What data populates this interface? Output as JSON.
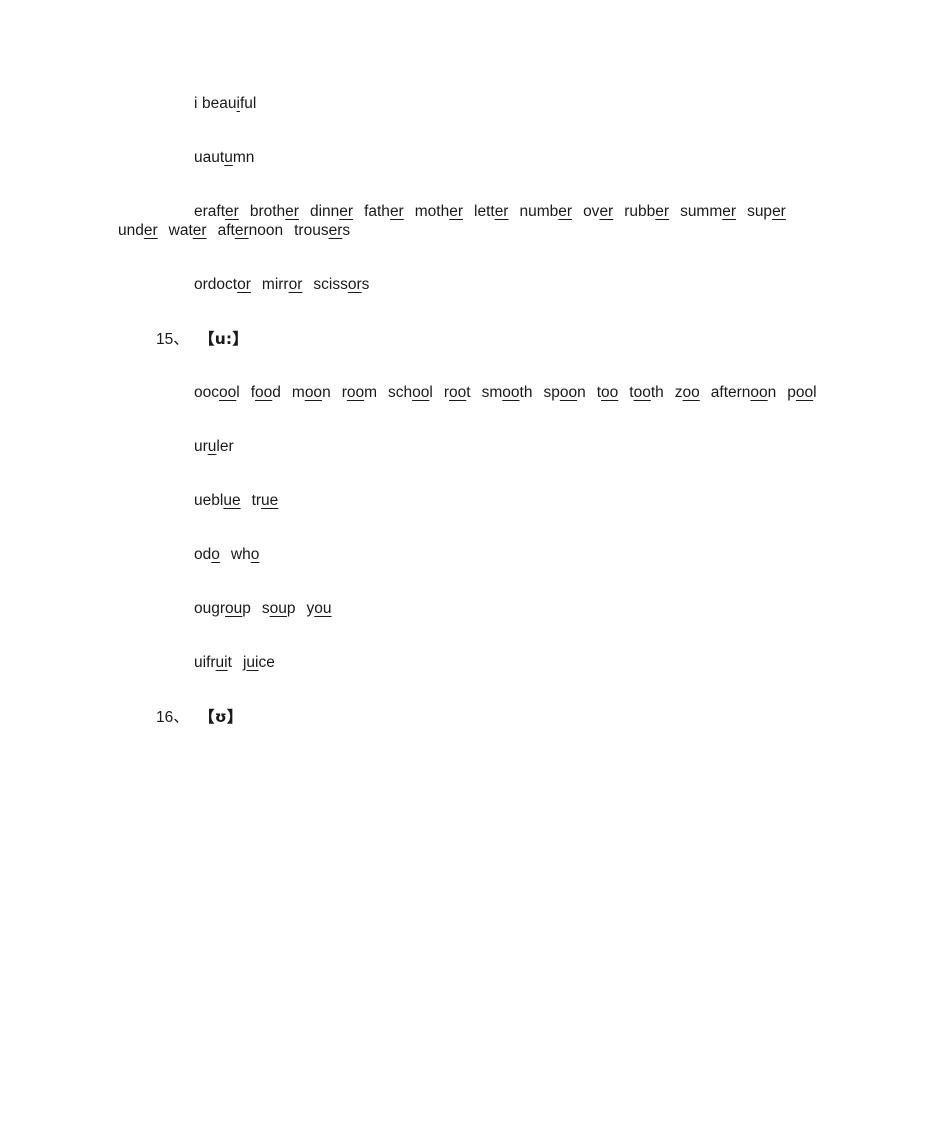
{
  "document": {
    "type": "english-phonics-worksheet",
    "background_color": "#ffffff",
    "text_color": "#1a1a1a"
  },
  "blocks": [
    {
      "kind": "entry",
      "name": "entry-i",
      "label": "i",
      "words": [
        {
          "pre": "beau",
          "mark": "i",
          "post": "ful",
          "text": "beauiful"
        }
      ]
    },
    {
      "kind": "entry",
      "name": "entry-u-schwa",
      "label": "u",
      "words": [
        {
          "pre": "aut",
          "mark": "u",
          "post": "mn",
          "text": "autumn"
        }
      ]
    },
    {
      "kind": "entry",
      "name": "entry-er",
      "label": "er",
      "words": [
        {
          "pre": "aft",
          "mark": "er",
          "post": "",
          "text": "after"
        },
        {
          "pre": "broth",
          "mark": "er",
          "post": "",
          "text": "brother"
        },
        {
          "pre": "dinn",
          "mark": "er",
          "post": "",
          "text": "dinner"
        },
        {
          "pre": "fath",
          "mark": "er",
          "post": "",
          "text": "father"
        },
        {
          "pre": "moth",
          "mark": "er",
          "post": "",
          "text": "mother"
        },
        {
          "pre": "lett",
          "mark": "er",
          "post": "",
          "text": "letter"
        },
        {
          "pre": "numb",
          "mark": "er",
          "post": "",
          "text": "number"
        },
        {
          "pre": "ov",
          "mark": "er",
          "post": "",
          "text": "over"
        },
        {
          "pre": "rubb",
          "mark": "er",
          "post": "",
          "text": "rubber"
        },
        {
          "pre": "summ",
          "mark": "er",
          "post": "",
          "text": "summer"
        },
        {
          "pre": "sup",
          "mark": "er",
          "post": "",
          "text": "super"
        },
        {
          "pre": "und",
          "mark": "er",
          "post": "",
          "text": "under"
        },
        {
          "pre": "wat",
          "mark": "er",
          "post": "",
          "text": "water"
        },
        {
          "pre": "aft",
          "mark": "er",
          "post": "noon",
          "text": "afternoon"
        },
        {
          "pre": "trous",
          "mark": "er",
          "post": "s",
          "text": "trousers"
        }
      ]
    },
    {
      "kind": "entry",
      "name": "entry-or",
      "label": "or",
      "words": [
        {
          "pre": "doct",
          "mark": "or",
          "post": "",
          "text": "doctor"
        },
        {
          "pre": "mirr",
          "mark": "or",
          "post": "",
          "text": "mirror"
        },
        {
          "pre": "sciss",
          "mark": "or",
          "post": "s",
          "text": "scissors"
        }
      ]
    },
    {
      "kind": "heading",
      "name": "heading-15",
      "number": "15、",
      "ipa": "【u:】"
    },
    {
      "kind": "entry",
      "name": "entry-oo",
      "label": "oo",
      "words": [
        {
          "pre": "c",
          "mark": "oo",
          "post": "l",
          "text": "cool"
        },
        {
          "pre": "f",
          "mark": "oo",
          "post": "d",
          "text": "food"
        },
        {
          "pre": "m",
          "mark": "oo",
          "post": "n",
          "text": "moon"
        },
        {
          "pre": "r",
          "mark": "oo",
          "post": "m",
          "text": "room"
        },
        {
          "pre": "sch",
          "mark": "oo",
          "post": "l",
          "text": "school"
        },
        {
          "pre": "r",
          "mark": "oo",
          "post": "t",
          "text": "root"
        },
        {
          "pre": "sm",
          "mark": "oo",
          "post": "th",
          "text": "smooth"
        },
        {
          "pre": "sp",
          "mark": "oo",
          "post": "n",
          "text": "spoon"
        },
        {
          "pre": "t",
          "mark": "oo",
          "post": "",
          "text": "too"
        },
        {
          "pre": "t",
          "mark": "oo",
          "post": "th",
          "text": "tooth"
        },
        {
          "pre": "z",
          "mark": "oo",
          "post": "",
          "text": "zoo"
        },
        {
          "pre": "aftern",
          "mark": "oo",
          "post": "n",
          "text": "afternoon"
        },
        {
          "pre": "p",
          "mark": "oo",
          "post": "l",
          "text": "pool"
        }
      ]
    },
    {
      "kind": "entry",
      "name": "entry-u-long",
      "label": "u",
      "words": [
        {
          "pre": "r",
          "mark": "u",
          "post": "ler",
          "text": "ruler"
        }
      ]
    },
    {
      "kind": "entry",
      "name": "entry-ue",
      "label": "ue",
      "words": [
        {
          "pre": "bl",
          "mark": "ue",
          "post": "",
          "text": "blue"
        },
        {
          "pre": "tr",
          "mark": "ue",
          "post": "",
          "text": "true"
        }
      ]
    },
    {
      "kind": "entry",
      "name": "entry-o",
      "label": "o",
      "words": [
        {
          "pre": "d",
          "mark": "o",
          "post": "",
          "text": "do"
        },
        {
          "pre": "wh",
          "mark": "o",
          "post": "",
          "text": "who"
        }
      ]
    },
    {
      "kind": "entry",
      "name": "entry-ou",
      "label": "ou",
      "words": [
        {
          "pre": "gr",
          "mark": "ou",
          "post": "p",
          "text": "group"
        },
        {
          "pre": "s",
          "mark": "ou",
          "post": "p",
          "text": "soup"
        },
        {
          "pre": "y",
          "mark": "ou",
          "post": "",
          "text": "you"
        }
      ]
    },
    {
      "kind": "entry",
      "name": "entry-ui",
      "label": "ui",
      "words": [
        {
          "pre": "fr",
          "mark": "ui",
          "post": "t",
          "text": "fruit"
        },
        {
          "pre": "j",
          "mark": "ui",
          "post": "ce",
          "text": "juice"
        }
      ]
    },
    {
      "kind": "heading",
      "name": "heading-16",
      "number": "16、",
      "ipa": "【ʊ】"
    }
  ]
}
